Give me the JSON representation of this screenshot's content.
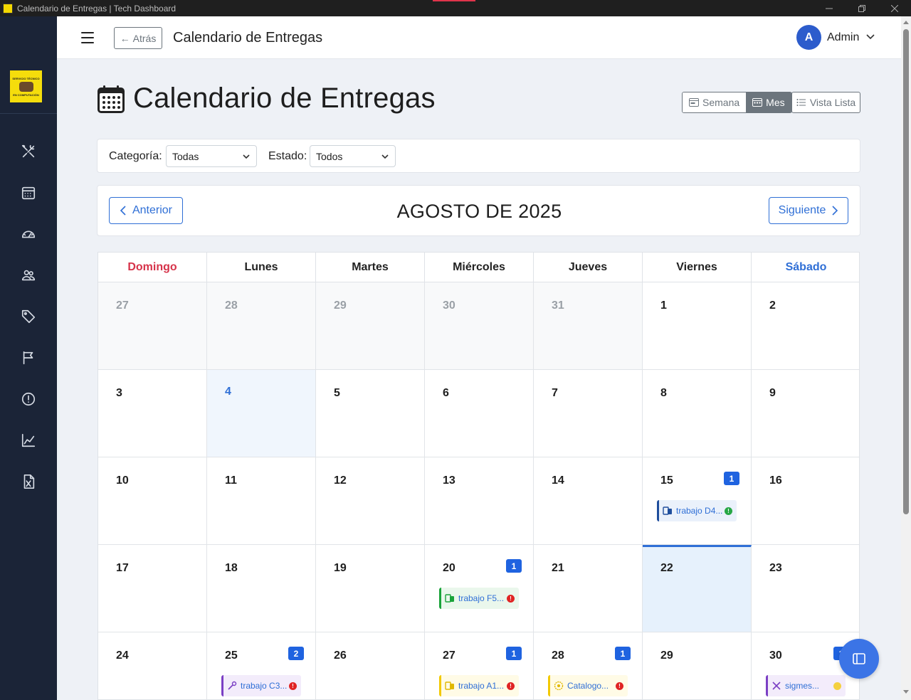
{
  "window": {
    "title": "Calendario de Entregas | Tech Dashboard",
    "controls": [
      "minimize-icon",
      "restore-icon",
      "close-icon"
    ]
  },
  "sidebar": {
    "logo_text": "SERVICIO TÉCNICO EN COMPUTACIÓN",
    "items": [
      {
        "icon": "tools-icon"
      },
      {
        "icon": "calendar-icon"
      },
      {
        "icon": "speedometer-icon"
      },
      {
        "icon": "people-icon"
      },
      {
        "icon": "tags-icon"
      },
      {
        "icon": "flag-icon"
      },
      {
        "icon": "alert-circle-icon"
      },
      {
        "icon": "chart-line-icon"
      },
      {
        "icon": "excel-file-icon"
      }
    ]
  },
  "header": {
    "back_label": "Atrás",
    "title": "Calendario de Entregas",
    "avatar_initial": "A",
    "user_name": "Admin"
  },
  "page": {
    "title": "Calendario de Entregas",
    "views": {
      "week": "Semana",
      "month": "Mes",
      "list": "Vista Lista",
      "active": "Mes"
    }
  },
  "filters": {
    "category_label": "Categoría:",
    "category_value": "Todas",
    "status_label": "Estado:",
    "status_value": "Todos"
  },
  "nav": {
    "prev_label": "Anterior",
    "month_label": "AGOSTO DE 2025",
    "next_label": "Siguiente"
  },
  "calendar": {
    "weekdays": [
      "Domingo",
      "Lunes",
      "Martes",
      "Miércoles",
      "Jueves",
      "Viernes",
      "Sábado"
    ],
    "today": 4,
    "selected": 22,
    "weeks": [
      [
        {
          "day": "27",
          "other": true
        },
        {
          "day": "28",
          "other": true
        },
        {
          "day": "29",
          "other": true
        },
        {
          "day": "30",
          "other": true
        },
        {
          "day": "31",
          "other": true
        },
        {
          "day": "1"
        },
        {
          "day": "2"
        }
      ],
      [
        {
          "day": "3"
        },
        {
          "day": "4",
          "today": true
        },
        {
          "day": "5"
        },
        {
          "day": "6"
        },
        {
          "day": "7"
        },
        {
          "day": "8"
        },
        {
          "day": "9"
        }
      ],
      [
        {
          "day": "10"
        },
        {
          "day": "11"
        },
        {
          "day": "12"
        },
        {
          "day": "13"
        },
        {
          "day": "14"
        },
        {
          "day": "15",
          "count": "1",
          "event": {
            "text": "trabajo D4...",
            "color": "#1f4e9c",
            "bg": "#eaf1fb",
            "dot": "#27a745",
            "icon": "devices-icon"
          }
        },
        {
          "day": "16"
        }
      ],
      [
        {
          "day": "17"
        },
        {
          "day": "18"
        },
        {
          "day": "19"
        },
        {
          "day": "20",
          "count": "1",
          "event": {
            "text": "trabajo F5...",
            "color": "#1aa33a",
            "bg": "#eaf7ec",
            "dot": "#e02424",
            "icon": "devices-icon"
          }
        },
        {
          "day": "21"
        },
        {
          "day": "22",
          "selected": true
        },
        {
          "day": "23"
        }
      ],
      [
        {
          "day": "24"
        },
        {
          "day": "25",
          "count": "2",
          "event": {
            "text": "trabajo C3...",
            "color": "#7b3fc4",
            "bg": "#f3ecfb",
            "dot": "#e02424",
            "icon": "wrench-icon"
          }
        },
        {
          "day": "26"
        },
        {
          "day": "27",
          "count": "1",
          "event": {
            "text": "trabajo A1...",
            "color": "#f2c900",
            "bg": "#fffbe6",
            "dot": "#e02424",
            "icon": "devices-icon"
          }
        },
        {
          "day": "28",
          "count": "1",
          "event": {
            "text": "Catalogo...",
            "color": "#f2c900",
            "bg": "#fffbe6",
            "dot": "#e02424",
            "icon": "gear-icon"
          }
        },
        {
          "day": "29"
        },
        {
          "day": "30",
          "count": "1",
          "event": {
            "text": "sigmes...",
            "color": "#7b3fc4",
            "bg": "#f3ecfb",
            "dot": "#f4d03f",
            "icon": "tools-icon"
          }
        }
      ]
    ]
  },
  "fab": {
    "icon": "sidebar-toggle-icon"
  }
}
